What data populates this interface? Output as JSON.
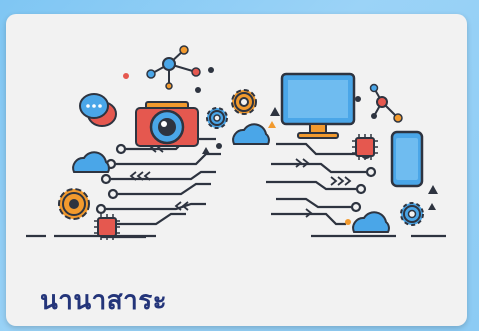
{
  "card": {
    "title": "นานาสาระ"
  },
  "illustration": {
    "icons": [
      "share-network-icon",
      "chat-bubble-icon",
      "camera-icon",
      "cloud-icon",
      "gear-icon",
      "monitor-icon",
      "chip-icon",
      "smartphone-icon",
      "triangle-icon",
      "circuit-lines-icon"
    ]
  },
  "colors": {
    "background": "#8ccbf4",
    "card": "#f2f2f2",
    "title": "#24357a",
    "accent_orange": "#f29a2e",
    "accent_blue": "#4aa6e8",
    "dark": "#2e3440"
  }
}
